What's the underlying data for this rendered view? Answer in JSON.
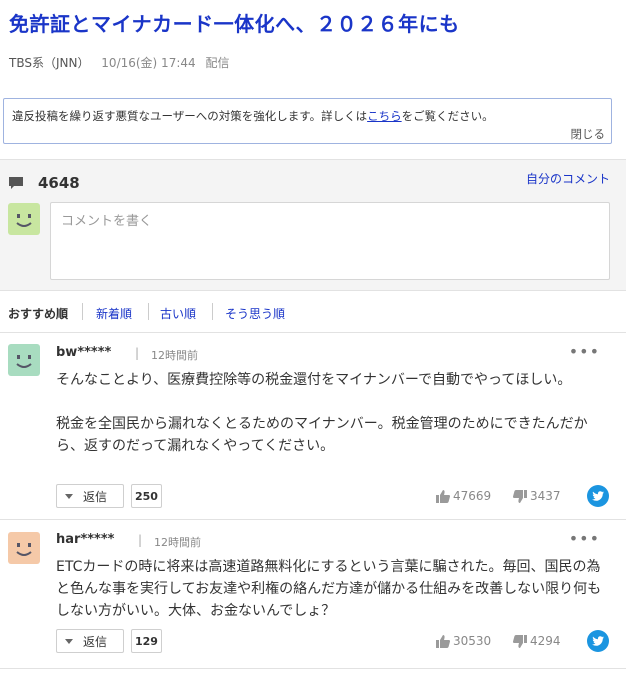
{
  "article": {
    "title": "免許証とマイナカード一体化へ、２０２６年にも",
    "source": "TBS系（JNN）",
    "date": "10/16(金) 17:44",
    "delivery": "配信"
  },
  "notice": {
    "text_before": "違反投稿を繰り返す悪質なユーザーへの対策を強化します。詳しくは",
    "link": "こちら",
    "text_after": "をご覧ください。",
    "close": "閉じる"
  },
  "comment_box": {
    "count": "4648",
    "my_comments": "自分のコメント",
    "placeholder": "コメントを書く"
  },
  "sort_tabs": [
    {
      "label": "おすすめ順",
      "active": true
    },
    {
      "label": "新着順",
      "active": false
    },
    {
      "label": "古い順",
      "active": false
    },
    {
      "label": "そう思う順",
      "active": false
    }
  ],
  "comments": [
    {
      "user": "bw*****",
      "separator": "|",
      "time": "12時間前",
      "more": "•••",
      "body": "そんなことより、医療費控除等の税金還付をマイナンバーで自動でやってほしい。\n\n税金を全国民から漏れなくとるためのマイナンバー。税金管理のためにできたんだから、返すのだって漏れなくやってください。",
      "reply_label": "返信",
      "reply_count": "250",
      "agree": "47669",
      "disagree": "3437",
      "avatar_color": "#a8dcc0"
    },
    {
      "user": "har*****",
      "separator": "|",
      "time": "12時間前",
      "more": "•••",
      "body": "ETCカードの時に将来は高速道路無料化にするという言葉に騙された。毎回、国民の為と色んな事を実行してお友達や利権の絡んだ方達が儲かる仕組みを改善しない限り何もしない方がいい。大体、お金ないんでしょ？",
      "reply_label": "返信",
      "reply_count": "129",
      "agree": "30530",
      "disagree": "4294",
      "avatar_color": "#f5c9a8"
    }
  ],
  "colors": {
    "link": "#1a35c8",
    "twitter": "#1b95e0",
    "my_avatar": "#c8e6a0"
  }
}
